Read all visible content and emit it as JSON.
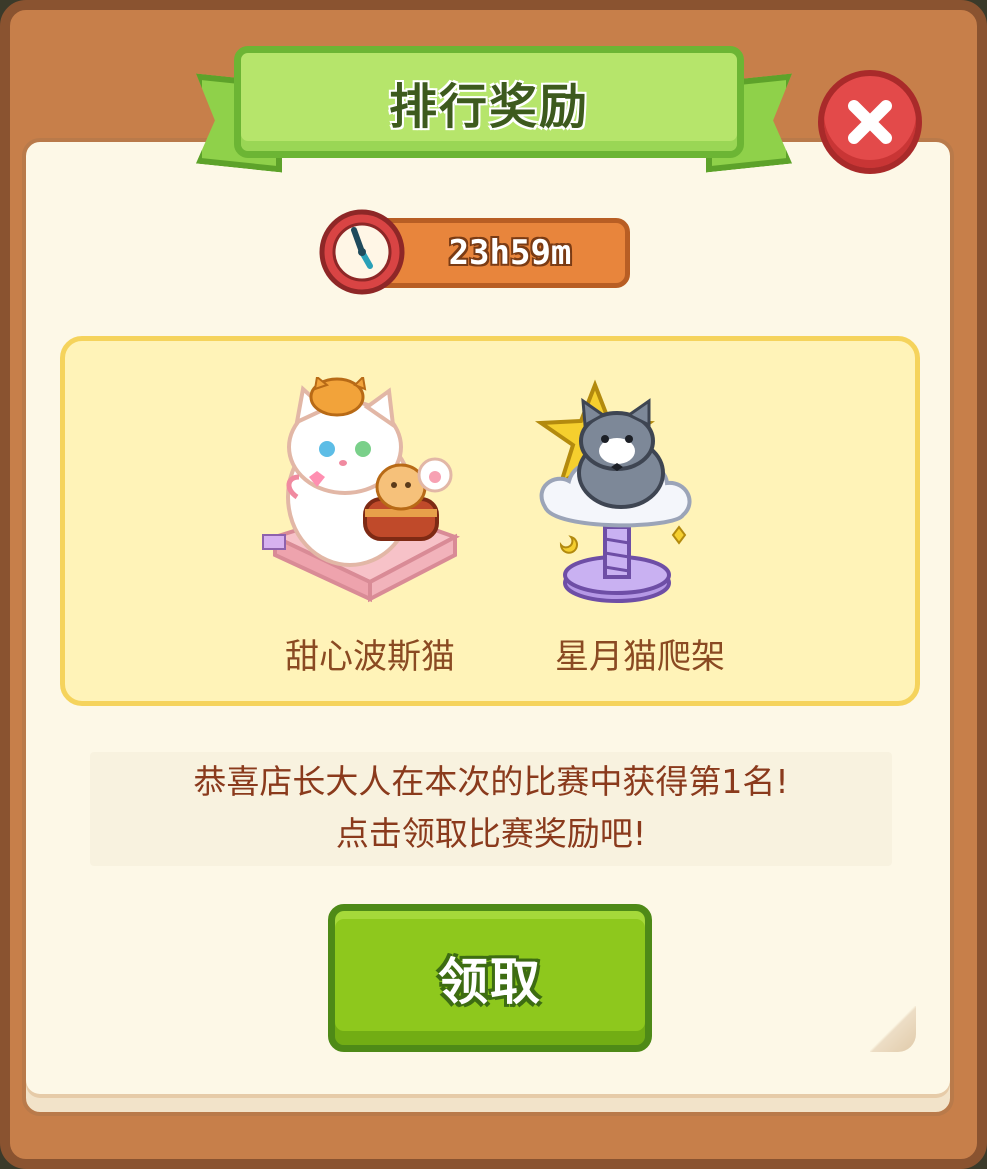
{
  "panel": {
    "title": "排行奖励",
    "close_icon": "close-icon"
  },
  "timer": {
    "icon": "clock-icon",
    "remaining": "23h59m"
  },
  "rewards": [
    {
      "name": "甜心波斯猫",
      "icon": "persian-cat-reward-icon"
    },
    {
      "name": "星月猫爬架",
      "icon": "star-moon-cat-tree-icon"
    }
  ],
  "message": {
    "line1": "恭喜店长大人在本次的比赛中获得第1名!",
    "line2": "点击领取比赛奖励吧!"
  },
  "claim_button": {
    "label": "领取"
  },
  "colors": {
    "frame": "#c77f4a",
    "paper": "#fdf8e7",
    "ribbon": "#b6e56b",
    "close_button": "#e34a4a",
    "timer_bar": "#e8853c",
    "reward_panel": "#fff3b8",
    "claim_button": "#8ec81d",
    "text_brown": "#8a3a1c"
  }
}
